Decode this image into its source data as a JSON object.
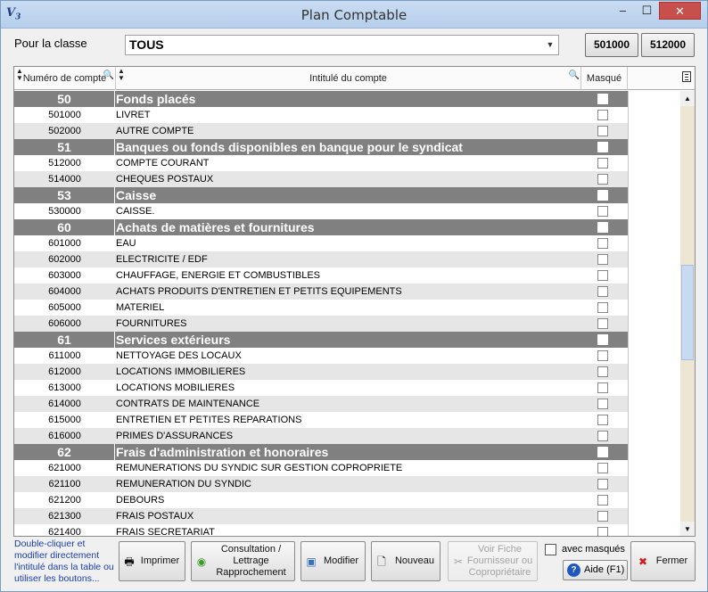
{
  "window": {
    "title": "Plan Comptable",
    "icon_text": "V",
    "icon_sub": "3",
    "controls": {
      "minimize": "–",
      "maximize": "☐",
      "close": "✕"
    }
  },
  "filter": {
    "label": "Pour la classe",
    "value": "TOUS",
    "arrow": "▼",
    "btn_a": "501000",
    "btn_b": "512000"
  },
  "grid": {
    "headers": {
      "numero": "Numéro de compte",
      "intitule": "Intitulé du compte",
      "masque": "Masqué"
    },
    "rows": [
      {
        "type": "group",
        "num": "50",
        "label": "Fonds placés"
      },
      {
        "type": "item",
        "num": "501000",
        "label": "LIVRET"
      },
      {
        "type": "item",
        "num": "502000",
        "label": "AUTRE COMPTE"
      },
      {
        "type": "group",
        "num": "51",
        "label": "Banques ou fonds disponibles en banque pour le syndicat"
      },
      {
        "type": "item",
        "num": "512000",
        "label": "COMPTE COURANT"
      },
      {
        "type": "item",
        "num": "514000",
        "label": "CHEQUES POSTAUX"
      },
      {
        "type": "group",
        "num": "53",
        "label": "Caisse"
      },
      {
        "type": "item",
        "num": "530000",
        "label": "CAISSE."
      },
      {
        "type": "group",
        "num": "60",
        "label": "Achats de matières et fournitures"
      },
      {
        "type": "item",
        "num": "601000",
        "label": "EAU"
      },
      {
        "type": "item",
        "num": "602000",
        "label": "ELECTRICITE / EDF"
      },
      {
        "type": "item",
        "num": "603000",
        "label": "CHAUFFAGE, ENERGIE ET COMBUSTIBLES"
      },
      {
        "type": "item",
        "num": "604000",
        "label": "ACHATS PRODUITS D'ENTRETIEN ET PETITS EQUIPEMENTS"
      },
      {
        "type": "item",
        "num": "605000",
        "label": "MATERIEL"
      },
      {
        "type": "item",
        "num": "606000",
        "label": "FOURNITURES"
      },
      {
        "type": "group",
        "num": "61",
        "label": "Services extérieurs"
      },
      {
        "type": "item",
        "num": "611000",
        "label": "NETTOYAGE DES LOCAUX"
      },
      {
        "type": "item",
        "num": "612000",
        "label": "LOCATIONS IMMOBILIERES"
      },
      {
        "type": "item",
        "num": "613000",
        "label": "LOCATIONS MOBILIERES"
      },
      {
        "type": "item",
        "num": "614000",
        "label": "CONTRATS DE MAINTENANCE"
      },
      {
        "type": "item",
        "num": "615000",
        "label": "ENTRETIEN ET PETITES REPARATIONS"
      },
      {
        "type": "item",
        "num": "616000",
        "label": "PRIMES D'ASSURANCES"
      },
      {
        "type": "group",
        "num": "62",
        "label": "Frais d'administration et honoraires"
      },
      {
        "type": "item",
        "num": "621000",
        "label": "REMUNERATIONS DU SYNDIC SUR GESTION COPROPRIETE"
      },
      {
        "type": "item",
        "num": "621100",
        "label": "REMUNERATION DU SYNDIC"
      },
      {
        "type": "item",
        "num": "621200",
        "label": "DEBOURS"
      },
      {
        "type": "item",
        "num": "621300",
        "label": "FRAIS POSTAUX"
      },
      {
        "type": "item",
        "num": "621400",
        "label": "FRAIS SECRETARIAT"
      }
    ],
    "scroll": {
      "up": "▲",
      "down": "▼"
    }
  },
  "footer": {
    "hint": "Double-cliquer et modifier directement l'intitulé dans la table ou utiliser les boutons...",
    "imprimer": "Imprimer",
    "consultation": "Consultation / Lettrage Rapprochement",
    "modifier": "Modifier",
    "nouveau": "Nouveau",
    "voir_fiche": "Voir Fiche Fournisseur ou Copropriétaire",
    "avec_masques": "avec masqués",
    "aide": "Aide (F1)",
    "aide_icon": "?",
    "fermer": "Fermer",
    "icons": {
      "imprimer": "🖶",
      "consultation": "◉",
      "modifier": "▣",
      "nouveau": "🗋",
      "voir_fiche": "✂",
      "fermer": "✖"
    },
    "colors": {
      "hint": "#1a3fb0",
      "fermer_icon": "#d11d1d",
      "consultation_icon": "#3a9a2a"
    }
  }
}
